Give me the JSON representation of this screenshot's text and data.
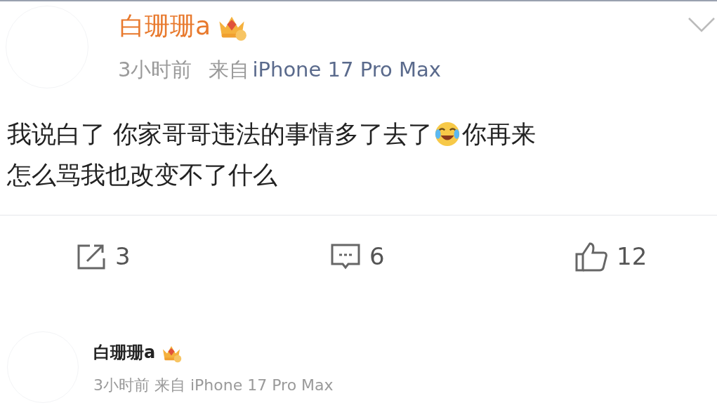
{
  "post": {
    "author": "白珊珊a",
    "time": "3小时前",
    "source_prefix": "来自",
    "source_device": "iPhone 17 Pro Max",
    "text_before": "我说白了 你家哥哥违法的事情多了去了",
    "text_after": "你再来",
    "text_second_line": "怎么骂我也改变不了什么",
    "actions": [
      {
        "kind": "repost",
        "count": "3"
      },
      {
        "kind": "comment",
        "count": "6"
      },
      {
        "kind": "like",
        "count": "12"
      }
    ]
  },
  "reply": {
    "author": "白珊珊a",
    "time": "3小时前",
    "source": "来自 iPhone 17 Pro Max"
  }
}
